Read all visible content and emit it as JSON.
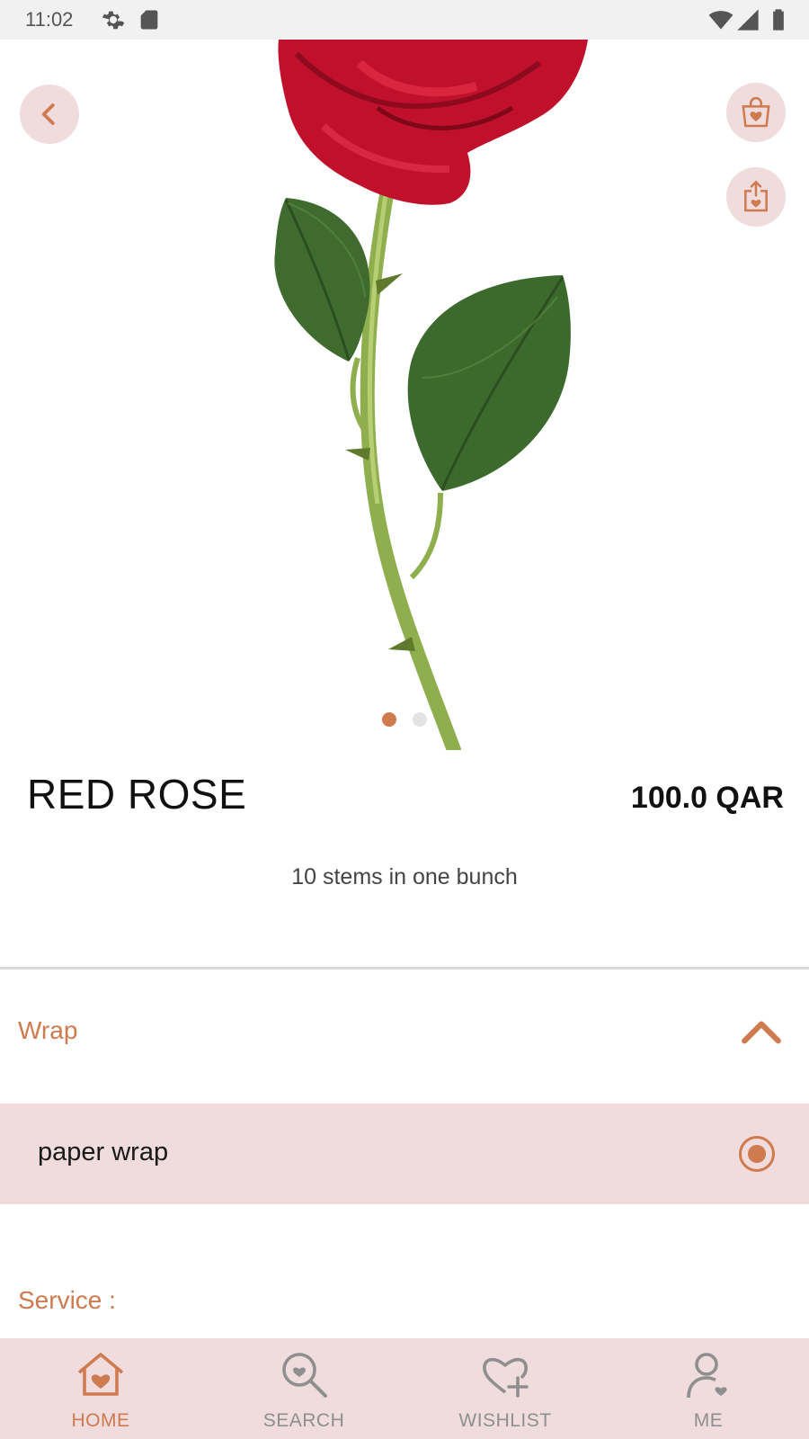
{
  "status_bar": {
    "time": "11:02",
    "icons": [
      "gear-icon",
      "sd-card-icon",
      "wifi-icon",
      "signal-icon",
      "battery-icon"
    ]
  },
  "hero": {
    "image": "red-rose-photo",
    "carousel": {
      "count": 2,
      "active_index": 0
    },
    "buttons": [
      "back-icon",
      "shopping-bag-heart-icon",
      "share-heart-icon"
    ]
  },
  "product": {
    "name": "RED ROSE",
    "price": "100.0 QAR",
    "description": "10 stems in one bunch"
  },
  "wrap": {
    "title": "Wrap",
    "expanded": true,
    "options": [
      {
        "label": "paper wrap",
        "selected": true
      }
    ]
  },
  "service": {
    "label": "Service :"
  },
  "bottom_nav": {
    "items": [
      {
        "label": "HOME",
        "icon": "home-heart-icon",
        "active": true
      },
      {
        "label": "SEARCH",
        "icon": "search-heart-icon",
        "active": false
      },
      {
        "label": "WISHLIST",
        "icon": "heart-plus-icon",
        "active": false
      },
      {
        "label": "ME",
        "icon": "user-heart-icon",
        "active": false
      }
    ]
  },
  "colors": {
    "accent": "#cf7a4f",
    "accent_soft": "#f0dcdc",
    "rose_red": "#c8102e",
    "leaf_green": "#3f6b2f"
  }
}
